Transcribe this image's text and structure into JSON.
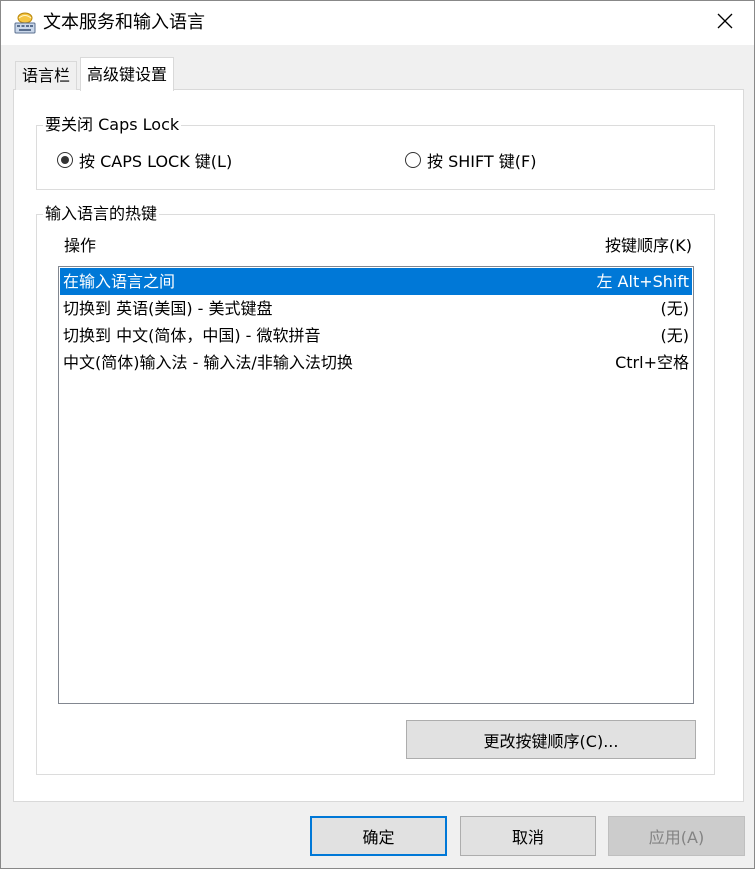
{
  "window": {
    "title": "文本服务和输入语言",
    "icon": "keyboard-globe-icon"
  },
  "tabs": [
    {
      "label": "语言栏",
      "active": false
    },
    {
      "label": "高级键设置",
      "active": true
    }
  ],
  "caps_lock_group": {
    "title": "要关闭 Caps Lock",
    "options": [
      {
        "label": "按 CAPS LOCK 键(L)",
        "selected": true
      },
      {
        "label": "按 SHIFT 键(F)",
        "selected": false
      }
    ]
  },
  "hotkeys_group": {
    "title": "输入语言的热键",
    "col_action": "操作",
    "col_key_sequence": "按键顺序(K)",
    "rows": [
      {
        "action": "在输入语言之间",
        "keys": "左 Alt+Shift",
        "selected": true
      },
      {
        "action": "切换到 英语(美国) - 美式键盘",
        "keys": "(无)",
        "selected": false
      },
      {
        "action": "切换到 中文(简体，中国) - 微软拼音",
        "keys": "(无)",
        "selected": false
      },
      {
        "action": "中文(简体)输入法 - 输入法/非输入法切换",
        "keys": "Ctrl+空格",
        "selected": false
      }
    ],
    "change_button": "更改按键顺序(C)..."
  },
  "footer": {
    "ok": "确定",
    "cancel": "取消",
    "apply": "应用(A)"
  },
  "colors": {
    "selection": "#0078d7",
    "focus_border": "#0078d7",
    "disabled_text": "#838383"
  }
}
